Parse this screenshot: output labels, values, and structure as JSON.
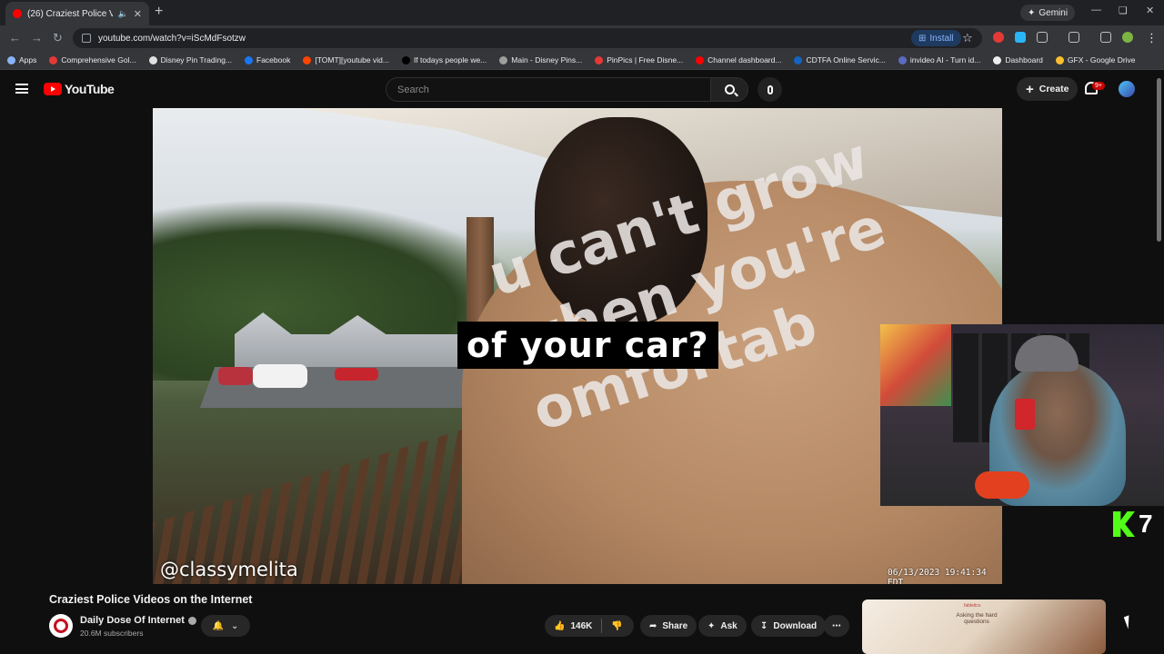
{
  "browser": {
    "tab_title": "(26) Craziest Police Videos o",
    "url": "youtube.com/watch?v=iScMdFsotzw",
    "gemini_label": "Gemini",
    "install_label": "Install",
    "bookmarks": [
      {
        "label": "Apps",
        "color": "#8ab4f8"
      },
      {
        "label": "Comprehensive Gol...",
        "color": "#e53935"
      },
      {
        "label": "Disney Pin Trading...",
        "color": "#e0e0e0"
      },
      {
        "label": "Facebook",
        "color": "#1877f2"
      },
      {
        "label": "[TOMT][youtube vid...",
        "color": "#ff4500"
      },
      {
        "label": "If todays people we...",
        "color": "#000000"
      },
      {
        "label": "Main - Disney Pins...",
        "color": "#9e9e9e"
      },
      {
        "label": "PinPics | Free Disne...",
        "color": "#e53935"
      },
      {
        "label": "Channel dashboard...",
        "color": "#ff0000"
      },
      {
        "label": "CDTFA Online Servic...",
        "color": "#1565c0"
      },
      {
        "label": "invideo AI - Turn id...",
        "color": "#5c6bc0"
      },
      {
        "label": "Dashboard",
        "color": "#eeeeee"
      },
      {
        "label": "GFX - Google Drive",
        "color": "#fbc02d"
      }
    ]
  },
  "youtube": {
    "logo_text": "YouTube",
    "search_placeholder": "Search",
    "create_label": "Create",
    "notification_badge": "9+"
  },
  "video": {
    "caption": "of your car?",
    "shirt_text": "u can't grow\nwhen you're\nomfortab",
    "watermark": "@classymelita",
    "timestamp": "06/13/2023 19:41:34 EDT",
    "kick_number": "7"
  },
  "details": {
    "title": "Craziest Police Videos on the Internet",
    "channel_name": "Daily Dose Of Internet",
    "subscribers": "20.6M subscribers",
    "likes": "146K",
    "share_label": "Share",
    "ask_label": "Ask",
    "download_label": "Download"
  },
  "recommended": {
    "thumb_text": "Asking the hard questions",
    "thumb_brand": "fabletics"
  },
  "colors": {
    "youtube_red": "#ff0000",
    "kick_green": "#53fc18",
    "background": "#0f0f0f"
  }
}
